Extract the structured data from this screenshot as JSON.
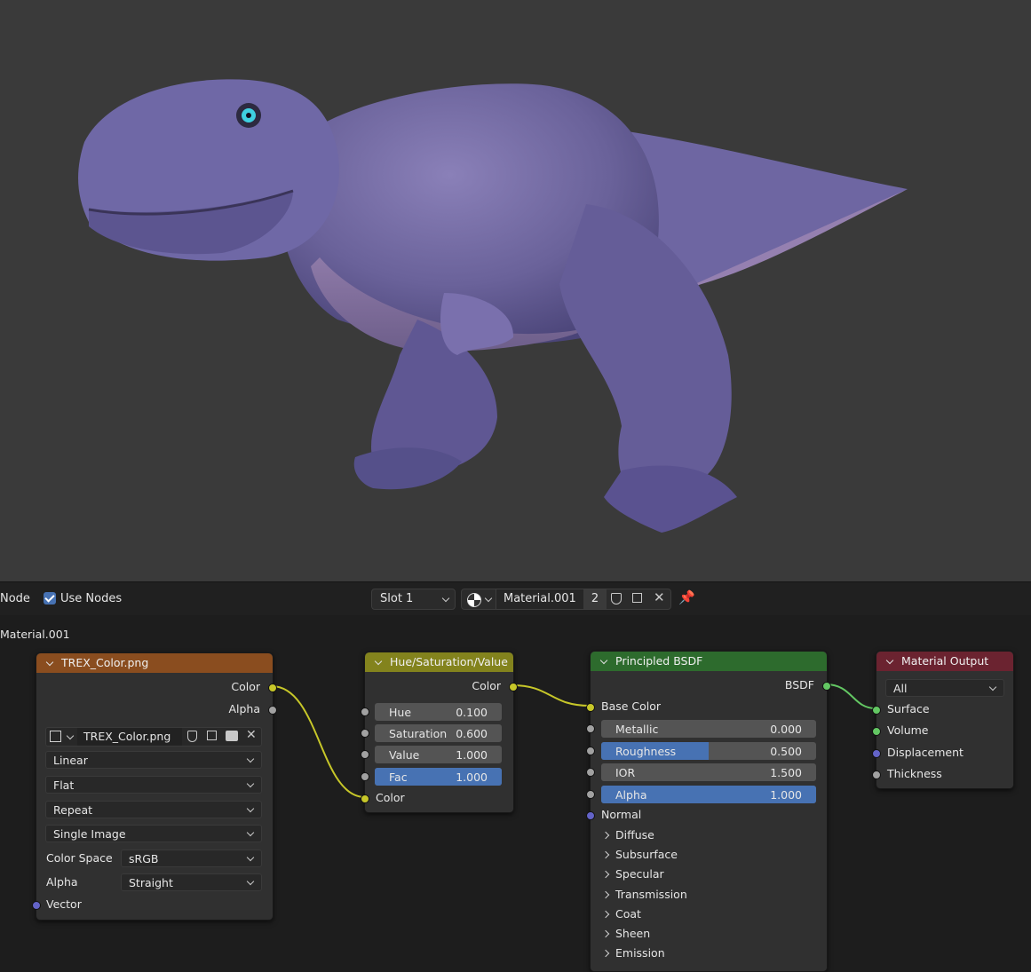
{
  "header": {
    "menu_node": "Node",
    "use_nodes_label": "Use Nodes",
    "slot": "Slot 1",
    "material_name": "Material.001",
    "user_count": "2",
    "breadcrumb": "Material.001"
  },
  "nodes": {
    "image_texture": {
      "title": "TREX_Color.png",
      "outputs": [
        "Color",
        "Alpha"
      ],
      "image_name": "TREX_Color.png",
      "interpolation": "Linear",
      "projection": "Flat",
      "extension": "Repeat",
      "source": "Single Image",
      "color_space_label": "Color Space",
      "color_space": "sRGB",
      "alpha_label": "Alpha",
      "alpha_mode": "Straight",
      "vector_input": "Vector"
    },
    "hsv": {
      "title": "Hue/Saturation/Value",
      "output": "Color",
      "fields": [
        {
          "label": "Hue",
          "value": "0.100"
        },
        {
          "label": "Saturation",
          "value": "0.600"
        },
        {
          "label": "Value",
          "value": "1.000"
        },
        {
          "label": "Fac",
          "value": "1.000"
        }
      ],
      "input": "Color"
    },
    "bsdf": {
      "title": "Principled BSDF",
      "output": "BSDF",
      "base_color": "Base Color",
      "fields": [
        {
          "label": "Metallic",
          "value": "0.000",
          "fill": 0
        },
        {
          "label": "Roughness",
          "value": "0.500",
          "fill": 0.5
        },
        {
          "label": "IOR",
          "value": "1.500",
          "fill": 0
        },
        {
          "label": "Alpha",
          "value": "1.000",
          "fill": 1
        }
      ],
      "normal": "Normal",
      "panels": [
        "Diffuse",
        "Subsurface",
        "Specular",
        "Transmission",
        "Coat",
        "Sheen",
        "Emission"
      ]
    },
    "output": {
      "title": "Material Output",
      "target": "All",
      "inputs": [
        "Surface",
        "Volume",
        "Displacement",
        "Thickness"
      ]
    }
  },
  "colors": {
    "texture_header": "#8a4d1f",
    "hsv_header": "#83831d",
    "bsdf_header": "#2d6b2d",
    "output_header": "#6b2330",
    "accent": "#4772b3"
  }
}
